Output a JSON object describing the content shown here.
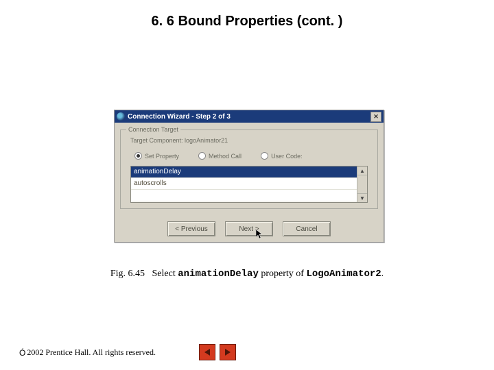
{
  "title": "6. 6   Bound Properties (cont. )",
  "dialog": {
    "title": "Connection Wizard - Step 2 of 3",
    "close_glyph": "✕",
    "fieldset_label": "Connection Target",
    "target_prefix": "Target Component: ",
    "target_value": "logoAnimator21",
    "radios": {
      "set_property": "Set Property",
      "method_call": "Method Call",
      "user_code": "User Code:"
    },
    "list": {
      "selected": "animationDelay",
      "row2": "autoscrolls",
      "row3": ""
    },
    "buttons": {
      "prev": "< Previous",
      "next": "Next >",
      "cancel": "Cancel"
    }
  },
  "caption": {
    "fig": "Fig. 6.45",
    "text_a": "Select ",
    "code_a": "animationDelay",
    "text_b": " property of ",
    "code_b": "LogoAnimator2",
    "text_c": "."
  },
  "footer": {
    "copy": "Ó",
    "text": " 2002 Prentice Hall.  All rights reserved."
  }
}
